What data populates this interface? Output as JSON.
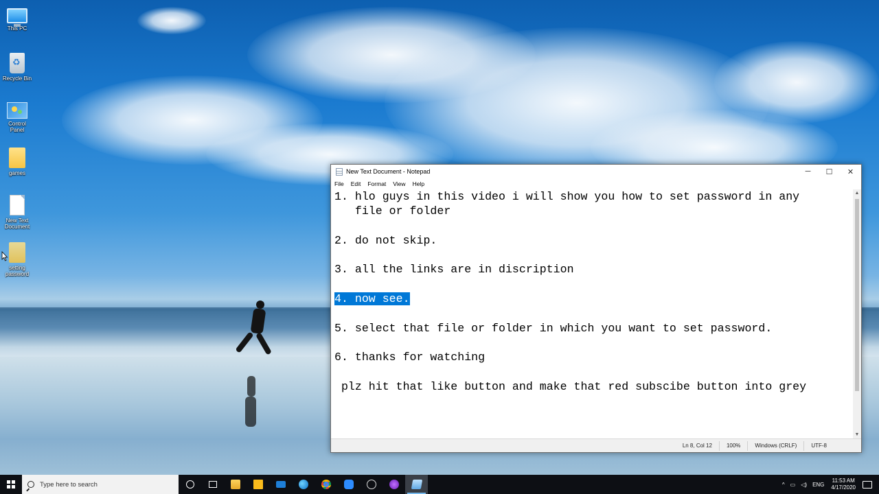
{
  "desktop": {
    "icons": [
      {
        "label": "This PC",
        "icon": "this-pc-icon"
      },
      {
        "label": "Recycle Bin",
        "icon": "recycle-bin-icon"
      },
      {
        "label": "Control Panel",
        "icon": "control-panel-icon"
      },
      {
        "label": "games",
        "icon": "folder-icon"
      },
      {
        "label": "New Text Document",
        "icon": "text-document-icon"
      },
      {
        "label": "setting password",
        "icon": "folder-icon"
      }
    ]
  },
  "notepad": {
    "title": "New Text Document - Notepad",
    "menu": [
      "File",
      "Edit",
      "Format",
      "View",
      "Help"
    ],
    "lines": [
      "1. hlo guys in this video i will show you how to set password in any",
      "   file or folder",
      "",
      "2. do not skip.",
      "",
      "3. all the links are in discription",
      "",
      "4. now see.",
      "",
      "5. select that file or folder in which you want to set password.",
      "",
      "6. thanks for watching",
      "",
      " plz hit that like button and make that red subscibe button into grey"
    ],
    "selected_text": "4. now see.",
    "status": {
      "position": "Ln 8, Col 12",
      "zoom": "100%",
      "line_endings": "Windows (CRLF)",
      "encoding": "UTF-8"
    },
    "window_buttons": {
      "minimize": "─",
      "maximize": "☐",
      "close": "✕"
    }
  },
  "taskbar": {
    "search_placeholder": "Type here to search",
    "apps": [
      "cortana-icon",
      "task-view-icon",
      "file-explorer-icon",
      "store-icon",
      "mail-icon",
      "edge-icon",
      "chrome-icon",
      "zoom-icon",
      "app-icon",
      "media-icon",
      "notepad-icon"
    ],
    "tray": {
      "language": "ENG",
      "time": "11:53 AM",
      "date": "4/17/2020"
    }
  },
  "colors": {
    "selection": "#0078d7",
    "taskbar": "#0d0f14",
    "accent": "#76b9ed"
  }
}
